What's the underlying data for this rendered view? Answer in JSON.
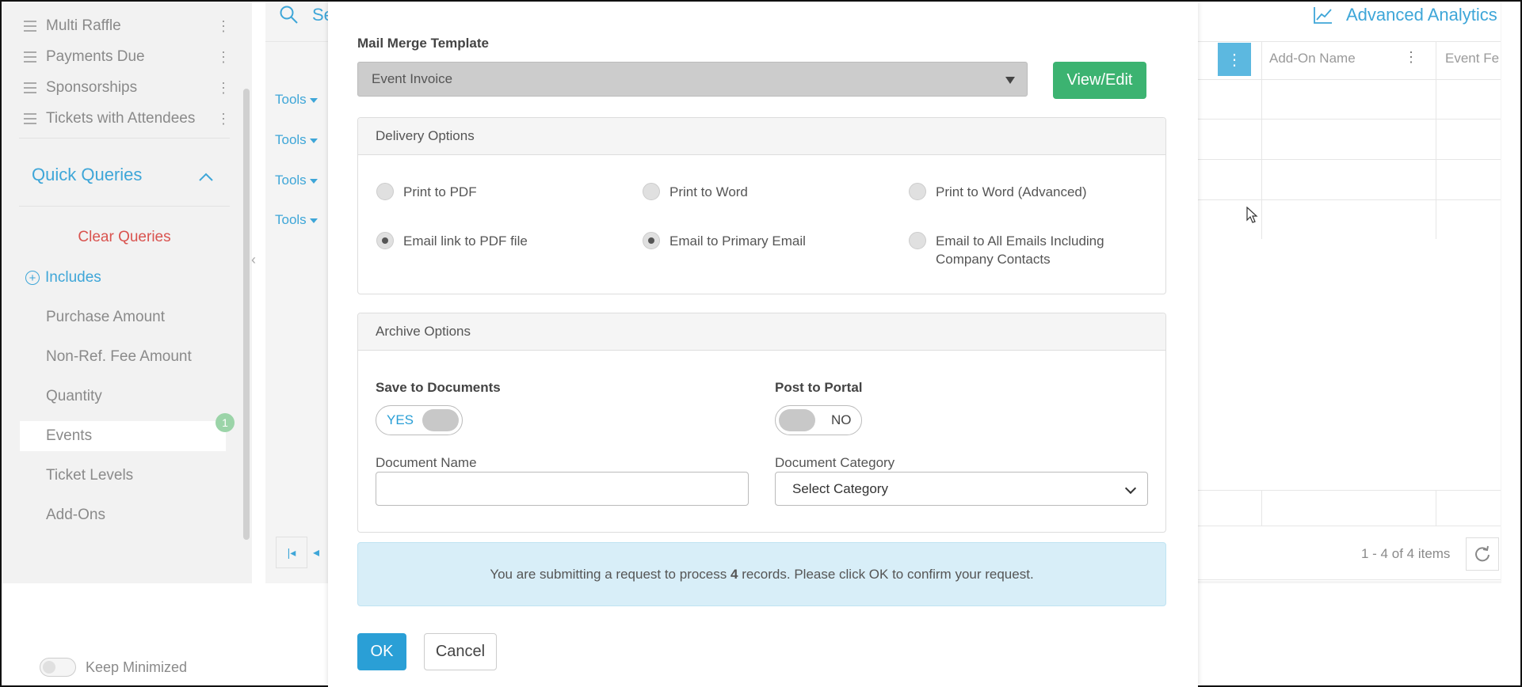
{
  "sidebar": {
    "saved_items": [
      "Multi Raffle",
      "Payments Due",
      "Sponsorships",
      "Tickets with Attendees"
    ],
    "quick_queries_title": "Quick Queries",
    "clear_queries": "Clear Queries",
    "includes_label": "Includes",
    "includes_items": [
      "Purchase Amount",
      "Non-Ref. Fee Amount",
      "Quantity",
      "Events",
      "Ticket Levels",
      "Add-Ons"
    ],
    "active_item": "Events",
    "events_badge": "1",
    "keep_minimized": "Keep Minimized",
    "keep_minimized_on": false
  },
  "grid": {
    "search_fragment": "Se",
    "tools_label": "Tools",
    "advanced_analytics": "Advanced Analytics",
    "columns": [
      "Add-On Name",
      "Event Fe"
    ],
    "pager_text": "1 - 4 of 4 items"
  },
  "modal": {
    "mail_merge_label": "Mail Merge Template",
    "template_value": "Event Invoice",
    "view_edit": "View/Edit",
    "delivery": {
      "title": "Delivery Options",
      "options": [
        {
          "label": "Print to PDF",
          "checked": false
        },
        {
          "label": "Print to Word",
          "checked": false
        },
        {
          "label": "Print to Word (Advanced)",
          "checked": false
        },
        {
          "label": "Email link to PDF file",
          "checked": true
        },
        {
          "label": "Email to Primary Email",
          "checked": true
        },
        {
          "label": "Email to All Emails Including Company Contacts",
          "checked": false
        }
      ]
    },
    "archive": {
      "title": "Archive Options",
      "save_to_documents": "Save to Documents",
      "save_toggle": "YES",
      "post_to_portal": "Post to Portal",
      "portal_toggle": "NO",
      "document_name_label": "Document Name",
      "document_name_value": "",
      "document_category_label": "Document Category",
      "document_category_value": "Select Category"
    },
    "info_prefix": "You are submitting a request to process ",
    "info_count": "4",
    "info_suffix": " records. Please click OK to confirm your request.",
    "ok": "OK",
    "cancel": "Cancel"
  },
  "colors": {
    "accent": "#3ea6d8",
    "success": "#3cb371",
    "danger": "#d9534f",
    "info_bg": "#d8eef8"
  }
}
